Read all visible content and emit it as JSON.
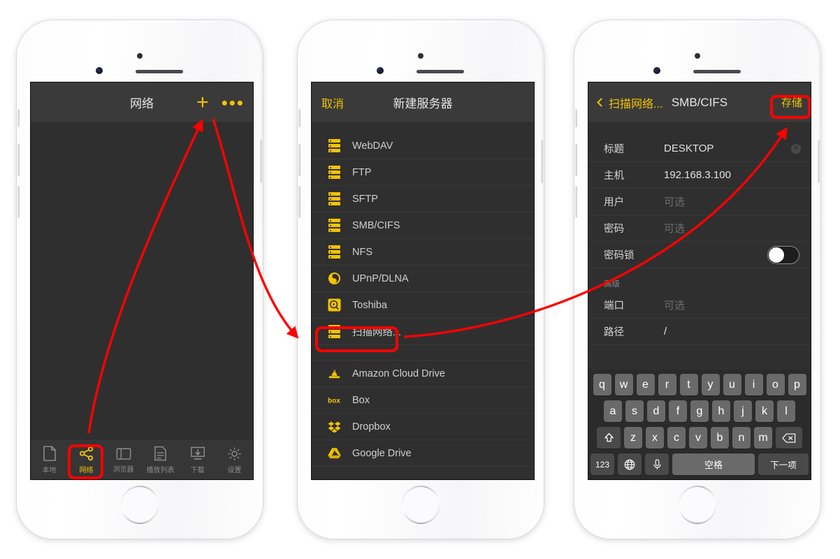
{
  "phone1": {
    "navbar": {
      "title": "网络",
      "add_icon": "plus-icon",
      "more_icon": "more-dots-icon"
    },
    "tabs": [
      {
        "label": "本地",
        "icon": "document-icon",
        "active": false
      },
      {
        "label": "网络",
        "icon": "share-network-icon",
        "active": true
      },
      {
        "label": "浏览器",
        "icon": "browser-window-icon",
        "active": false
      },
      {
        "label": "播放列表",
        "icon": "playlist-icon",
        "active": false
      },
      {
        "label": "下载",
        "icon": "download-icon",
        "active": false
      },
      {
        "label": "设置",
        "icon": "gear-icon",
        "active": false
      }
    ]
  },
  "phone2": {
    "navbar": {
      "cancel": "取消",
      "title": "新建服务器"
    },
    "items": [
      {
        "label": "WebDAV",
        "icon": "server-stack-icon"
      },
      {
        "label": "FTP",
        "icon": "server-stack-icon"
      },
      {
        "label": "SFTP",
        "icon": "server-stack-icon"
      },
      {
        "label": "SMB/CIFS",
        "icon": "server-stack-icon"
      },
      {
        "label": "NFS",
        "icon": "server-stack-icon"
      },
      {
        "label": "UPnP/DLNA",
        "icon": "upnp-dlna-icon"
      },
      {
        "label": "Toshiba",
        "icon": "toshiba-drive-icon"
      },
      {
        "label": "扫描网络...",
        "icon": "server-stack-icon",
        "highlighted": true
      }
    ],
    "cloud_items": [
      {
        "label": "Amazon Cloud Drive",
        "icon": "amazon-cloud-drive-icon"
      },
      {
        "label": "Box",
        "icon": "box-icon"
      },
      {
        "label": "Dropbox",
        "icon": "dropbox-icon"
      },
      {
        "label": "Google Drive",
        "icon": "google-drive-icon"
      }
    ]
  },
  "phone3": {
    "navbar": {
      "back": "扫描网络...",
      "title": "SMB/CIFS",
      "save": "存储"
    },
    "fields": [
      {
        "label": "标题",
        "value": "DESKTOP",
        "placeholder": false,
        "clear": true
      },
      {
        "label": "主机",
        "value": "192.168.3.100",
        "placeholder": false,
        "clear": false
      },
      {
        "label": "用户",
        "value": "可选",
        "placeholder": true,
        "clear": false
      },
      {
        "label": "密码",
        "value": "可选",
        "placeholder": true,
        "clear": false
      },
      {
        "label": "密码锁",
        "value": "",
        "toggle": true,
        "toggle_on": false
      }
    ],
    "advanced_header": "高级",
    "advanced_fields": [
      {
        "label": "端口",
        "value": "可选",
        "placeholder": true
      },
      {
        "label": "路径",
        "value": "/",
        "placeholder": false
      }
    ],
    "keyboard": {
      "row1": [
        "q",
        "w",
        "e",
        "r",
        "t",
        "y",
        "u",
        "i",
        "o",
        "p"
      ],
      "row2": [
        "a",
        "s",
        "d",
        "f",
        "g",
        "h",
        "j",
        "k",
        "l"
      ],
      "row3": [
        "z",
        "x",
        "c",
        "v",
        "b",
        "n",
        "m"
      ],
      "shift_icon": "shift-arrow-icon",
      "backspace_icon": "backspace-icon",
      "numbers_key": "123",
      "globe_icon": "globe-icon",
      "mic_icon": "microphone-icon",
      "space_key": "空格",
      "next_key": "下一项"
    }
  },
  "colors": {
    "accent": "#f3c300",
    "highlight": "#ff0000",
    "screen_bg": "#2f2f2f",
    "navbar_bg": "#3a3a3a"
  }
}
